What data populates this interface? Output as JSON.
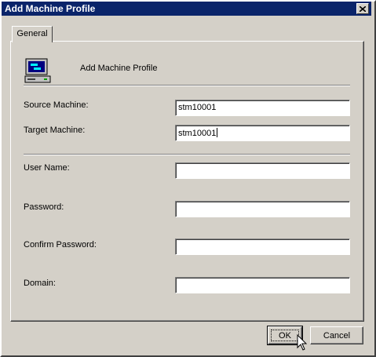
{
  "window": {
    "title": "Add Machine Profile",
    "close_icon": "close-icon"
  },
  "tabs": [
    {
      "label": "General",
      "selected": true
    }
  ],
  "header": {
    "icon": "computer-monitor-icon",
    "title": "Add Machine Profile"
  },
  "form": {
    "source_machine": {
      "label": "Source Machine:",
      "value": "stm10001"
    },
    "target_machine": {
      "label": "Target Machine:",
      "value": "stm10001"
    },
    "user_name": {
      "label": "User Name:",
      "value": ""
    },
    "password": {
      "label": "Password:",
      "value": ""
    },
    "confirm_password": {
      "label": "Confirm Password:",
      "value": ""
    },
    "domain": {
      "label": "Domain:",
      "value": ""
    }
  },
  "buttons": {
    "ok_label": "OK",
    "cancel_label": "Cancel"
  },
  "colors": {
    "titlebar": "#0a246a",
    "face": "#d4d0c8"
  }
}
